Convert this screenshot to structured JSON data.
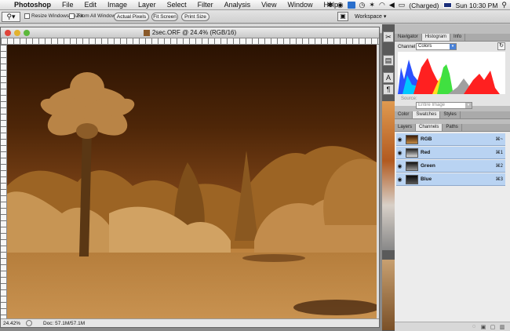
{
  "menubar": {
    "app": "Photoshop",
    "items": [
      "File",
      "Edit",
      "Image",
      "Layer",
      "Select",
      "Filter",
      "Analysis",
      "View",
      "Window",
      "Help"
    ],
    "battery": "(Charged)",
    "clock": "Sun 10:30 PM"
  },
  "options": {
    "resize_label": "Resize Windows To Fit",
    "zoom_all_label": "Zoom All Windows",
    "actual_pixels": "Actual Pixels",
    "fit_screen": "Fit Screen",
    "print_size": "Print Size",
    "workspace": "Workspace"
  },
  "document": {
    "title": "2sec.ORF @ 24.4% (RGB/16)",
    "zoom": "24.42%",
    "doc_size": "Doc: 57.1M/57.1M"
  },
  "histogram": {
    "tabs": [
      "Navigator",
      "Histogram",
      "Info"
    ],
    "channel_label": "Channel:",
    "channel_value": "Colors",
    "source_label": "Source:",
    "source_value": "Entire Image"
  },
  "color_panel": {
    "tabs": [
      "Color",
      "Swatches",
      "Styles"
    ]
  },
  "layers_panel": {
    "tabs": [
      "Layers",
      "Channels",
      "Paths"
    ],
    "channels": [
      {
        "name": "RGB",
        "shortcut": "⌘~"
      },
      {
        "name": "Red",
        "shortcut": "⌘1"
      },
      {
        "name": "Green",
        "shortcut": "⌘2"
      },
      {
        "name": "Blue",
        "shortcut": "⌘3"
      }
    ]
  },
  "colors": {
    "selection": "#b9d3f2",
    "accent": "#3b78d8"
  }
}
